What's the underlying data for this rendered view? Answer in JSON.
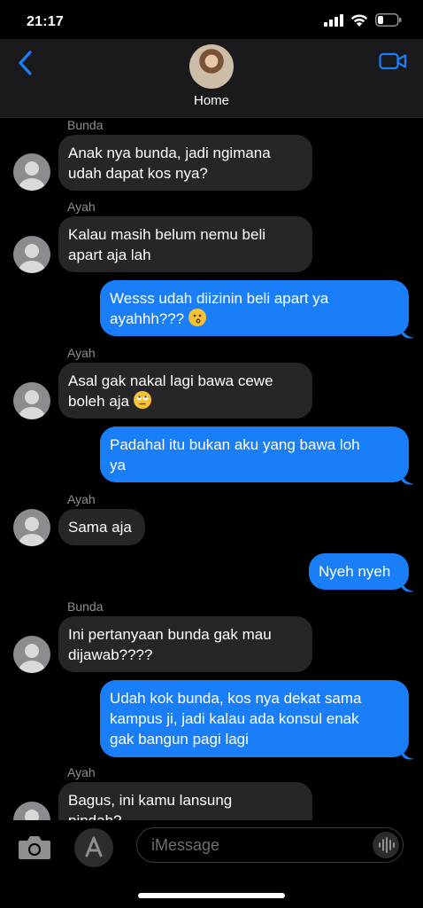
{
  "status_bar": {
    "time": "21:17"
  },
  "header": {
    "contact_name": "Home"
  },
  "messages": [
    {
      "sender": "Bunda",
      "text": "Anak nya bunda, jadi ngimana\nudah dapat kos nya?",
      "direction": "in"
    },
    {
      "sender": "Ayah",
      "text": "Kalau masih belum nemu beli\napart aja lah",
      "direction": "in"
    },
    {
      "text": "Wesss udah diizinin beli apart ya\nayahhh???",
      "direction": "out",
      "emoji": "kissing-face"
    },
    {
      "sender": "Ayah",
      "text": "Asal gak nakal lagi bawa cewe\nboleh aja",
      "direction": "in",
      "emoji": "eye-roll-face"
    },
    {
      "text": "Padahal itu bukan aku yang bawa loh\nya",
      "direction": "out"
    },
    {
      "sender": "Ayah",
      "text": "Sama aja",
      "direction": "in"
    },
    {
      "text": "Nyeh nyeh",
      "direction": "out"
    },
    {
      "sender": "Bunda",
      "text": "Ini pertanyaan bunda gak mau\ndijawab????",
      "direction": "in"
    },
    {
      "text": "Udah kok bunda, kos nya dekat sama\nkampus ji, jadi kalau ada konsul enak\ngak bangun pagi lagi",
      "direction": "out"
    },
    {
      "sender": "Ayah",
      "text": "Bagus, ini kamu lansung\npindah?",
      "direction": "in"
    }
  ],
  "input": {
    "placeholder": "iMessage"
  },
  "colors": {
    "outgoing_bubble": "#1a7ef8",
    "incoming_bubble": "#262628",
    "accent": "#1a7ef8"
  }
}
